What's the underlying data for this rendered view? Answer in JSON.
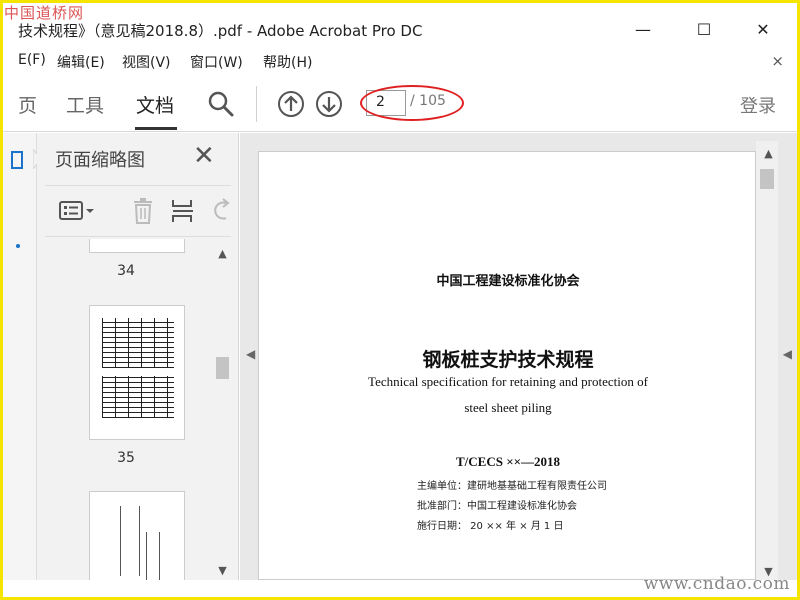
{
  "watermark": {
    "top_left": "中国道桥网",
    "bottom_right": "www.cndao.com"
  },
  "window": {
    "title": "技术规程》（意见稿2018.8）.pdf - Adobe Acrobat Pro DC",
    "minimize_glyph": "—",
    "maximize_glyph": "☐",
    "close_glyph": "✕"
  },
  "menubar": {
    "items": [
      "E(F)",
      "编辑(E)",
      "视图(V)",
      "窗口(W)",
      "帮助(H)"
    ],
    "close_glyph": "×"
  },
  "toolbar": {
    "tabs": [
      "页",
      "工具",
      "文档"
    ],
    "active_tab": "文档",
    "current_page": "2",
    "total_pages": "/ 105",
    "login_label": "登录",
    "icons": [
      "search-icon",
      "page-up-icon",
      "page-down-icon"
    ]
  },
  "thumbnail_panel": {
    "title": "页面缩略图",
    "close_glyph": "✕",
    "tool_icons": [
      "options-icon",
      "delete-icon",
      "insert-page-icon",
      "rotate-icon"
    ],
    "thumbnails": [
      {
        "label": "34"
      },
      {
        "label": "35"
      },
      {
        "label": ""
      }
    ]
  },
  "document_page": {
    "organization": "中国工程建设标准化协会",
    "title": "钢板桩支护技术规程",
    "english_title_line1": "Technical specification for retaining and protection of",
    "english_title_line2": "steel sheet piling",
    "code": "T/CECS ××—2018",
    "meta": [
      "主编单位：建研地基基础工程有限责任公司",
      "批准部门：中国工程建设标准化协会",
      "施行日期：    20  ××  年  ×  月  1  日"
    ]
  },
  "colors": {
    "frame": "#f5e400",
    "annotation": "#e02020",
    "watermark_tl": "#dd5555"
  }
}
